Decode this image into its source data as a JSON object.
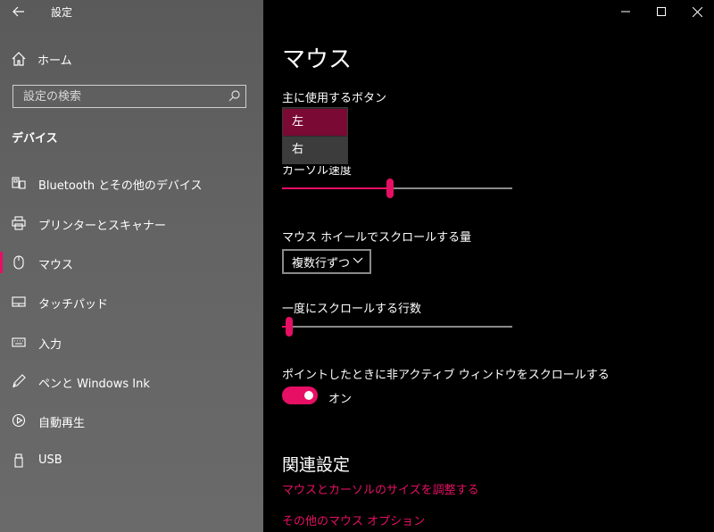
{
  "window": {
    "title": "設定"
  },
  "sidebar": {
    "home_label": "ホーム",
    "search_placeholder": "設定の検索",
    "section_title": "デバイス",
    "items": [
      {
        "label": "Bluetooth とその他のデバイス",
        "icon": "bluetooth-device-icon"
      },
      {
        "label": "プリンターとスキャナー",
        "icon": "printer-icon"
      },
      {
        "label": "マウス",
        "icon": "mouse-icon",
        "active": true
      },
      {
        "label": "タッチパッド",
        "icon": "touchpad-icon"
      },
      {
        "label": "入力",
        "icon": "keyboard-icon"
      },
      {
        "label": "ペンと Windows Ink",
        "icon": "pen-icon"
      },
      {
        "label": "自動再生",
        "icon": "autoplay-icon"
      },
      {
        "label": "USB",
        "icon": "usb-icon"
      }
    ]
  },
  "main": {
    "title": "マウス",
    "primary_button": {
      "label": "主に使用するボタン",
      "options": [
        "左",
        "右"
      ],
      "selected": "左"
    },
    "cursor_speed": {
      "label": "カーソル速度",
      "value": 0.47
    },
    "wheel_scroll": {
      "label": "マウス ホイールでスクロールする量",
      "value": "複数行ずつ"
    },
    "lines_to_scroll": {
      "label": "一度にスクロールする行数",
      "value": 0.03
    },
    "inactive_scroll": {
      "label": "ポイントしたときに非アクティブ ウィンドウをスクロールする",
      "state": "オン"
    },
    "related": {
      "title": "関連設定",
      "links": [
        "マウスとカーソルのサイズを調整する",
        "その他のマウス オプション"
      ]
    }
  },
  "colors": {
    "accent": "#e60f64",
    "sidebar_bg": "#646464",
    "main_bg": "#000000"
  }
}
